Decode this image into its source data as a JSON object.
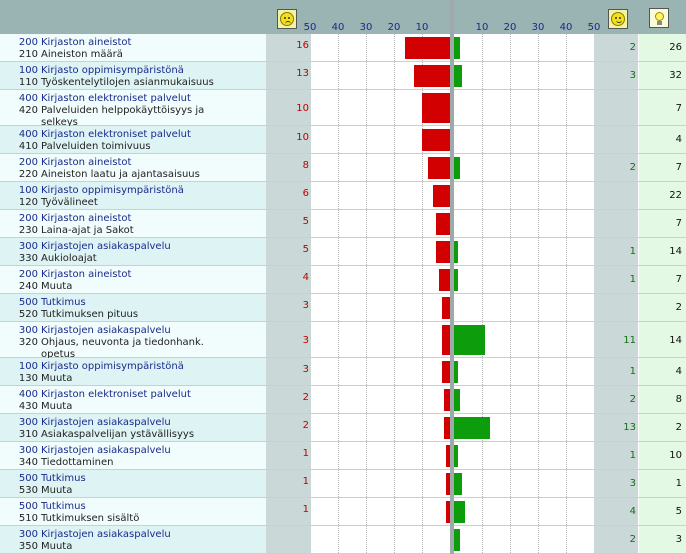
{
  "header": {
    "negative_icon": "sad-face-icon",
    "positive_icon": "happy-face-icon",
    "suggestion_icon": "lightbulb-icon",
    "left_ticks": [
      "50",
      "40",
      "30",
      "20",
      "10"
    ],
    "right_ticks": [
      "10",
      "20",
      "30",
      "40",
      "50"
    ]
  },
  "colors": {
    "negative_bar": "#d20000",
    "positive_bar": "#0c9c0c",
    "category_text": "#1a2a8c",
    "negative_count_text": "#c00000",
    "positive_count_text": "#127012"
  },
  "rows": [
    {
      "cat_code": "200",
      "cat_name": "Kirjaston aineistot",
      "sub_code": "210",
      "sub_lines": [
        "Aineiston määrä"
      ],
      "negative": "16",
      "positive": "2",
      "suggestions": "26"
    },
    {
      "cat_code": "100",
      "cat_name": "Kirjasto oppimisympäristönä",
      "sub_code": "110",
      "sub_lines": [
        "Työskentelytilojen asianmukaisuus"
      ],
      "negative": "13",
      "positive": "3",
      "suggestions": "32"
    },
    {
      "cat_code": "400",
      "cat_name": "Kirjaston elektroniset palvelut",
      "sub_code": "420",
      "sub_lines": [
        "Palveluiden helppokäyttöisyys ja",
        "selkeys"
      ],
      "negative": "10",
      "positive": "",
      "suggestions": "7"
    },
    {
      "cat_code": "400",
      "cat_name": "Kirjaston elektroniset palvelut",
      "sub_code": "410",
      "sub_lines": [
        "Palveluiden toimivuus"
      ],
      "negative": "10",
      "positive": "",
      "suggestions": "4"
    },
    {
      "cat_code": "200",
      "cat_name": "Kirjaston aineistot",
      "sub_code": "220",
      "sub_lines": [
        "Aineiston laatu ja ajantasaisuus"
      ],
      "negative": "8",
      "positive": "2",
      "suggestions": "7"
    },
    {
      "cat_code": "100",
      "cat_name": "Kirjasto oppimisympäristönä",
      "sub_code": "120",
      "sub_lines": [
        "Työvälineet"
      ],
      "negative": "6",
      "positive": "",
      "suggestions": "22"
    },
    {
      "cat_code": "200",
      "cat_name": "Kirjaston aineistot",
      "sub_code": "230",
      "sub_lines": [
        "Laina-ajat ja Sakot"
      ],
      "negative": "5",
      "positive": "",
      "suggestions": "7"
    },
    {
      "cat_code": "300",
      "cat_name": "Kirjastojen asiakaspalvelu",
      "sub_code": "330",
      "sub_lines": [
        "Aukioloajat"
      ],
      "negative": "5",
      "positive": "1",
      "suggestions": "14"
    },
    {
      "cat_code": "200",
      "cat_name": "Kirjaston aineistot",
      "sub_code": "240",
      "sub_lines": [
        "Muuta"
      ],
      "negative": "4",
      "positive": "1",
      "suggestions": "7"
    },
    {
      "cat_code": "500",
      "cat_name": "Tutkimus",
      "sub_code": "520",
      "sub_lines": [
        "Tutkimuksen pituus"
      ],
      "negative": "3",
      "positive": "",
      "suggestions": "2"
    },
    {
      "cat_code": "300",
      "cat_name": "Kirjastojen asiakaspalvelu",
      "sub_code": "320",
      "sub_lines": [
        "Ohjaus, neuvonta ja tiedonhank.",
        "opetus"
      ],
      "negative": "3",
      "positive": "11",
      "suggestions": "14"
    },
    {
      "cat_code": "100",
      "cat_name": "Kirjasto oppimisympäristönä",
      "sub_code": "130",
      "sub_lines": [
        "Muuta"
      ],
      "negative": "3",
      "positive": "1",
      "suggestions": "4"
    },
    {
      "cat_code": "400",
      "cat_name": "Kirjaston elektroniset palvelut",
      "sub_code": "430",
      "sub_lines": [
        "Muuta"
      ],
      "negative": "2",
      "positive": "2",
      "suggestions": "8"
    },
    {
      "cat_code": "300",
      "cat_name": "Kirjastojen asiakaspalvelu",
      "sub_code": "310",
      "sub_lines": [
        "Asiakaspalvelijan ystävällisyys"
      ],
      "negative": "2",
      "positive": "13",
      "suggestions": "2"
    },
    {
      "cat_code": "300",
      "cat_name": "Kirjastojen asiakaspalvelu",
      "sub_code": "340",
      "sub_lines": [
        "Tiedottaminen"
      ],
      "negative": "1",
      "positive": "1",
      "suggestions": "10"
    },
    {
      "cat_code": "500",
      "cat_name": "Tutkimus",
      "sub_code": "530",
      "sub_lines": [
        "Muuta"
      ],
      "negative": "1",
      "positive": "3",
      "suggestions": "1"
    },
    {
      "cat_code": "500",
      "cat_name": "Tutkimus",
      "sub_code": "510",
      "sub_lines": [
        "Tutkimuksen sisältö"
      ],
      "negative": "1",
      "positive": "4",
      "suggestions": "5"
    },
    {
      "cat_code": "300",
      "cat_name": "Kirjastojen asiakaspalvelu",
      "sub_code": "350",
      "sub_lines": [
        "Muuta"
      ],
      "negative": "",
      "positive": "2",
      "suggestions": "3"
    }
  ]
}
